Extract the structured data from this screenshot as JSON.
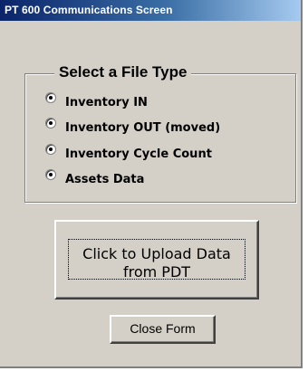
{
  "window": {
    "title": "PT 600 Communications Screen"
  },
  "file_type_group": {
    "legend": "Select a File Type",
    "options": [
      {
        "label": "Inventory IN"
      },
      {
        "label": "Inventory OUT (moved)"
      },
      {
        "label": "Inventory Cycle Count"
      },
      {
        "label": "Assets Data"
      }
    ]
  },
  "buttons": {
    "upload_label": "Click to Upload Data\nfrom PDT",
    "close_label": "Close Form"
  },
  "colors": {
    "window_face": "#d4d0c8",
    "titlebar_start": "#0a246a",
    "titlebar_end": "#a6caf0"
  }
}
